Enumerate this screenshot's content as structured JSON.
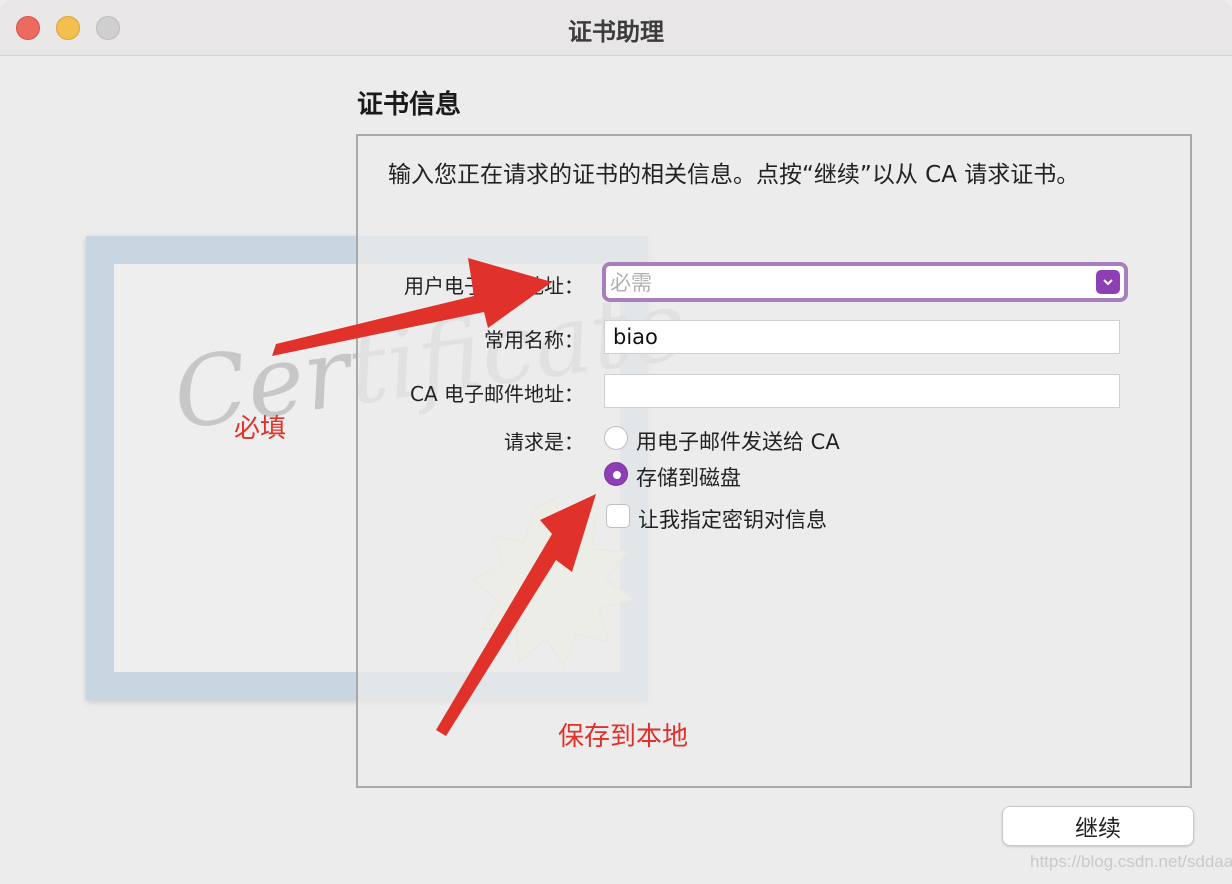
{
  "window": {
    "title": "证书助理"
  },
  "section_title": "证书信息",
  "intro_text": "输入您正在请求的证书的相关信息。点按“继续”以从 CA 请求证书。",
  "certificate_script": "Certificate",
  "form": {
    "email_label": "用户电子邮件地址：",
    "email_placeholder": "必需",
    "email_value": "",
    "common_name_label": "常用名称：",
    "common_name_value": "biao",
    "ca_email_label": "CA 电子邮件地址：",
    "ca_email_value": "",
    "request_label": "请求是：",
    "option_email_ca": "用电子邮件发送给 CA",
    "option_save_disk": "存储到磁盘",
    "selected_option": "存储到磁盘",
    "option_key_pair": "让我指定密钥对信息",
    "key_pair_checked": false
  },
  "continue_button": "继续",
  "annotations": {
    "required": "必填",
    "save_local": "保存到本地"
  },
  "watermark": "https://blog.csdn.net/sddaaa",
  "colors": {
    "accent": "#8e3fb5",
    "annotation": "#e0322b"
  }
}
